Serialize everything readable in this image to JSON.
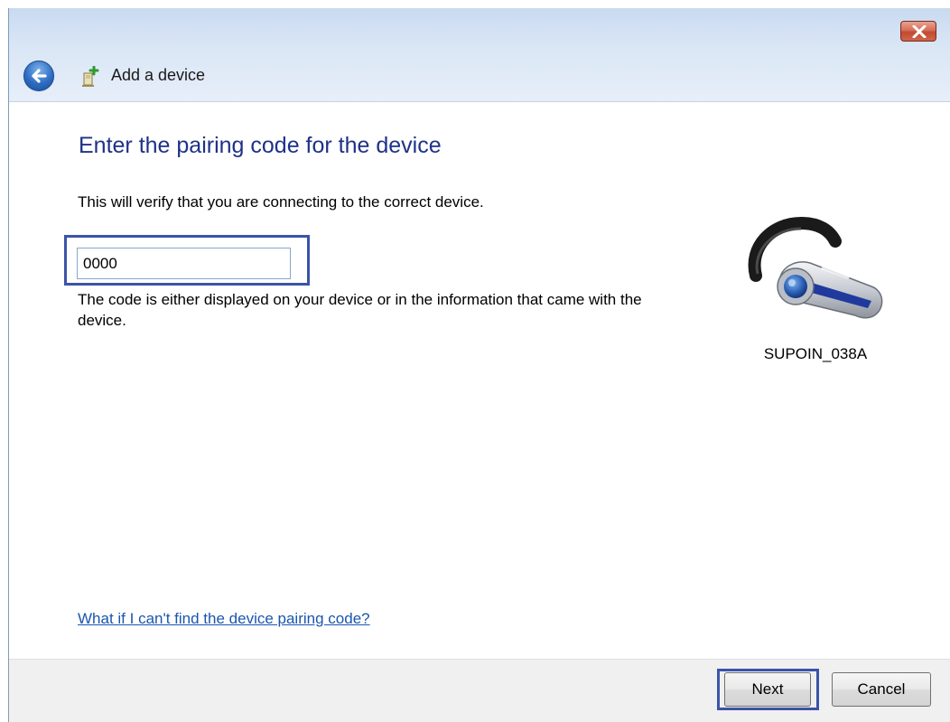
{
  "window": {
    "title": "Add a device",
    "close_icon": "close-icon",
    "back_icon": "back-arrow-icon",
    "app_icon": "add-device-icon"
  },
  "main": {
    "heading": "Enter the pairing code for the device",
    "description": "This will verify that you are connecting to the correct device.",
    "pairing_code": "0000",
    "hint": "The code is either displayed on your device or in the information that came with the device.",
    "help_link": "What if I can't find the device pairing code?"
  },
  "device": {
    "icon": "bluetooth-headset-icon",
    "name": "SUPOIN_038A"
  },
  "footer": {
    "next_label": "Next",
    "cancel_label": "Cancel"
  },
  "colors": {
    "heading": "#1e3287",
    "link": "#1a55b0",
    "focus_border": "#3b53a8",
    "close_button": "#c24a30"
  }
}
